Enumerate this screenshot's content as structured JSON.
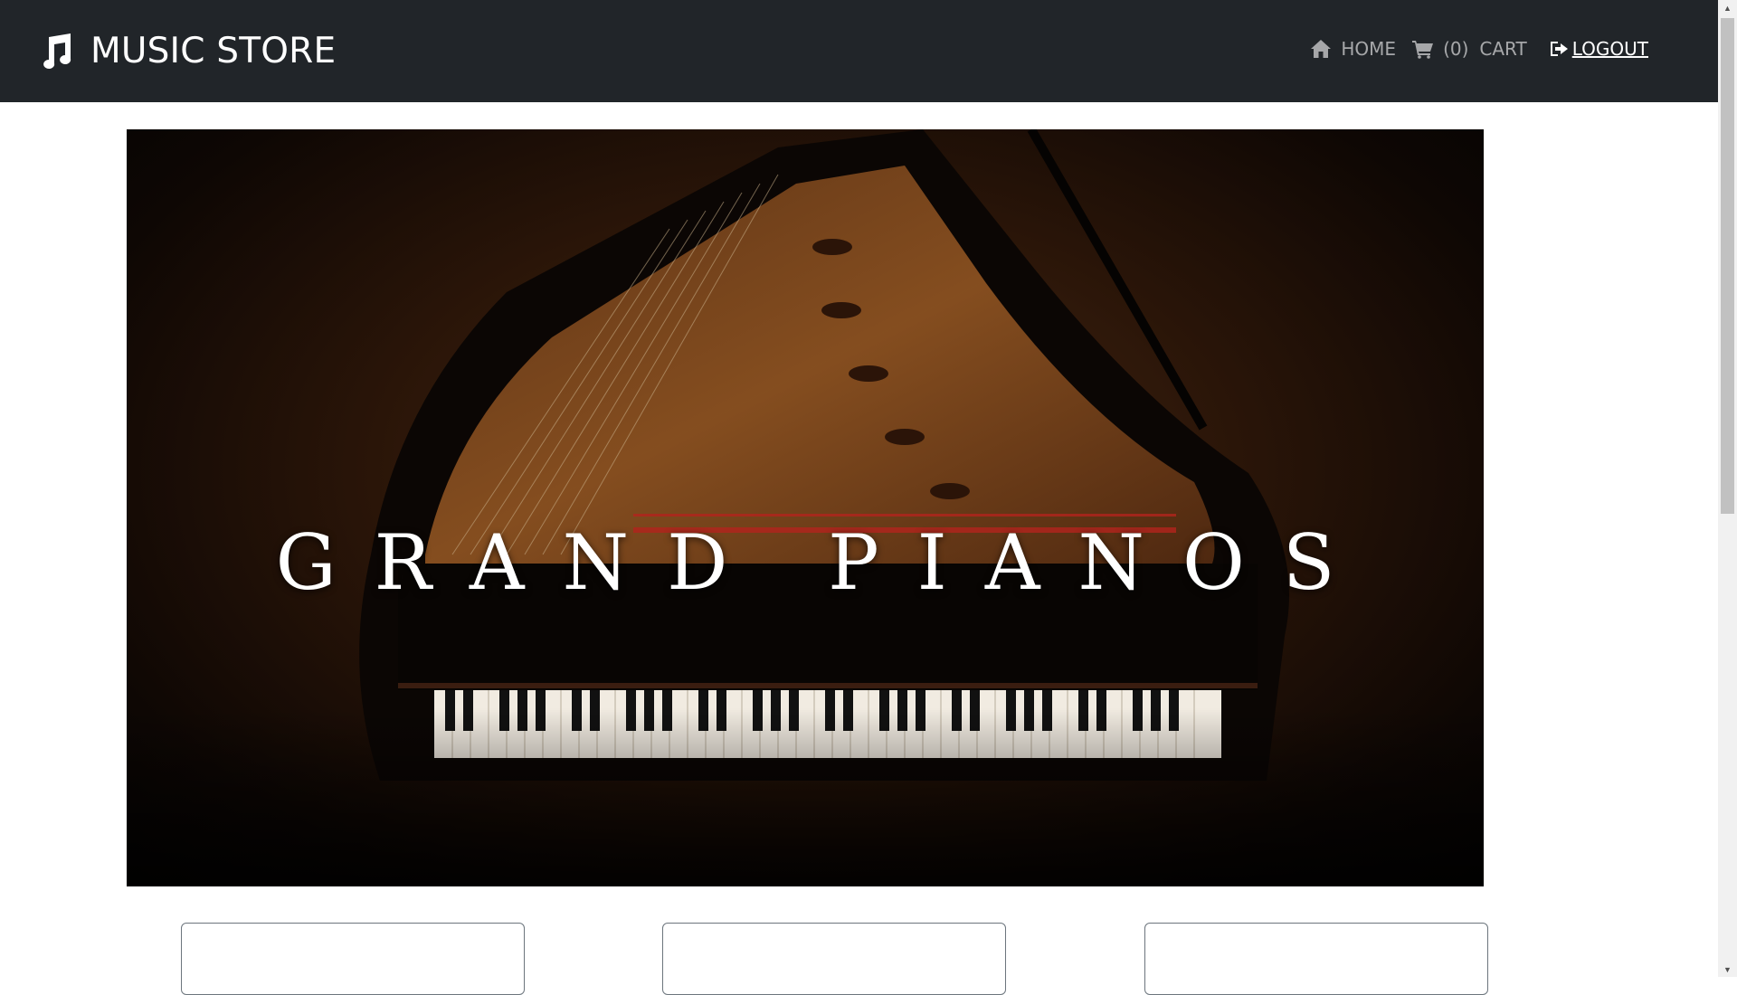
{
  "brand": {
    "name": "MUSIC STORE",
    "icon": "music-note-icon"
  },
  "nav": {
    "home": {
      "label": "HOME",
      "icon": "home-icon"
    },
    "cart": {
      "count": "(0)",
      "label": "CART",
      "icon": "cart-icon"
    },
    "logout": {
      "label": "LOGOUT",
      "icon": "logout-icon"
    }
  },
  "banner": {
    "title": "GRAND PIANOS",
    "image": "grand-piano-photo"
  },
  "colors": {
    "navbar": "#212529",
    "nav_text": "#9a9c9e",
    "card_border": "#6c757d"
  }
}
